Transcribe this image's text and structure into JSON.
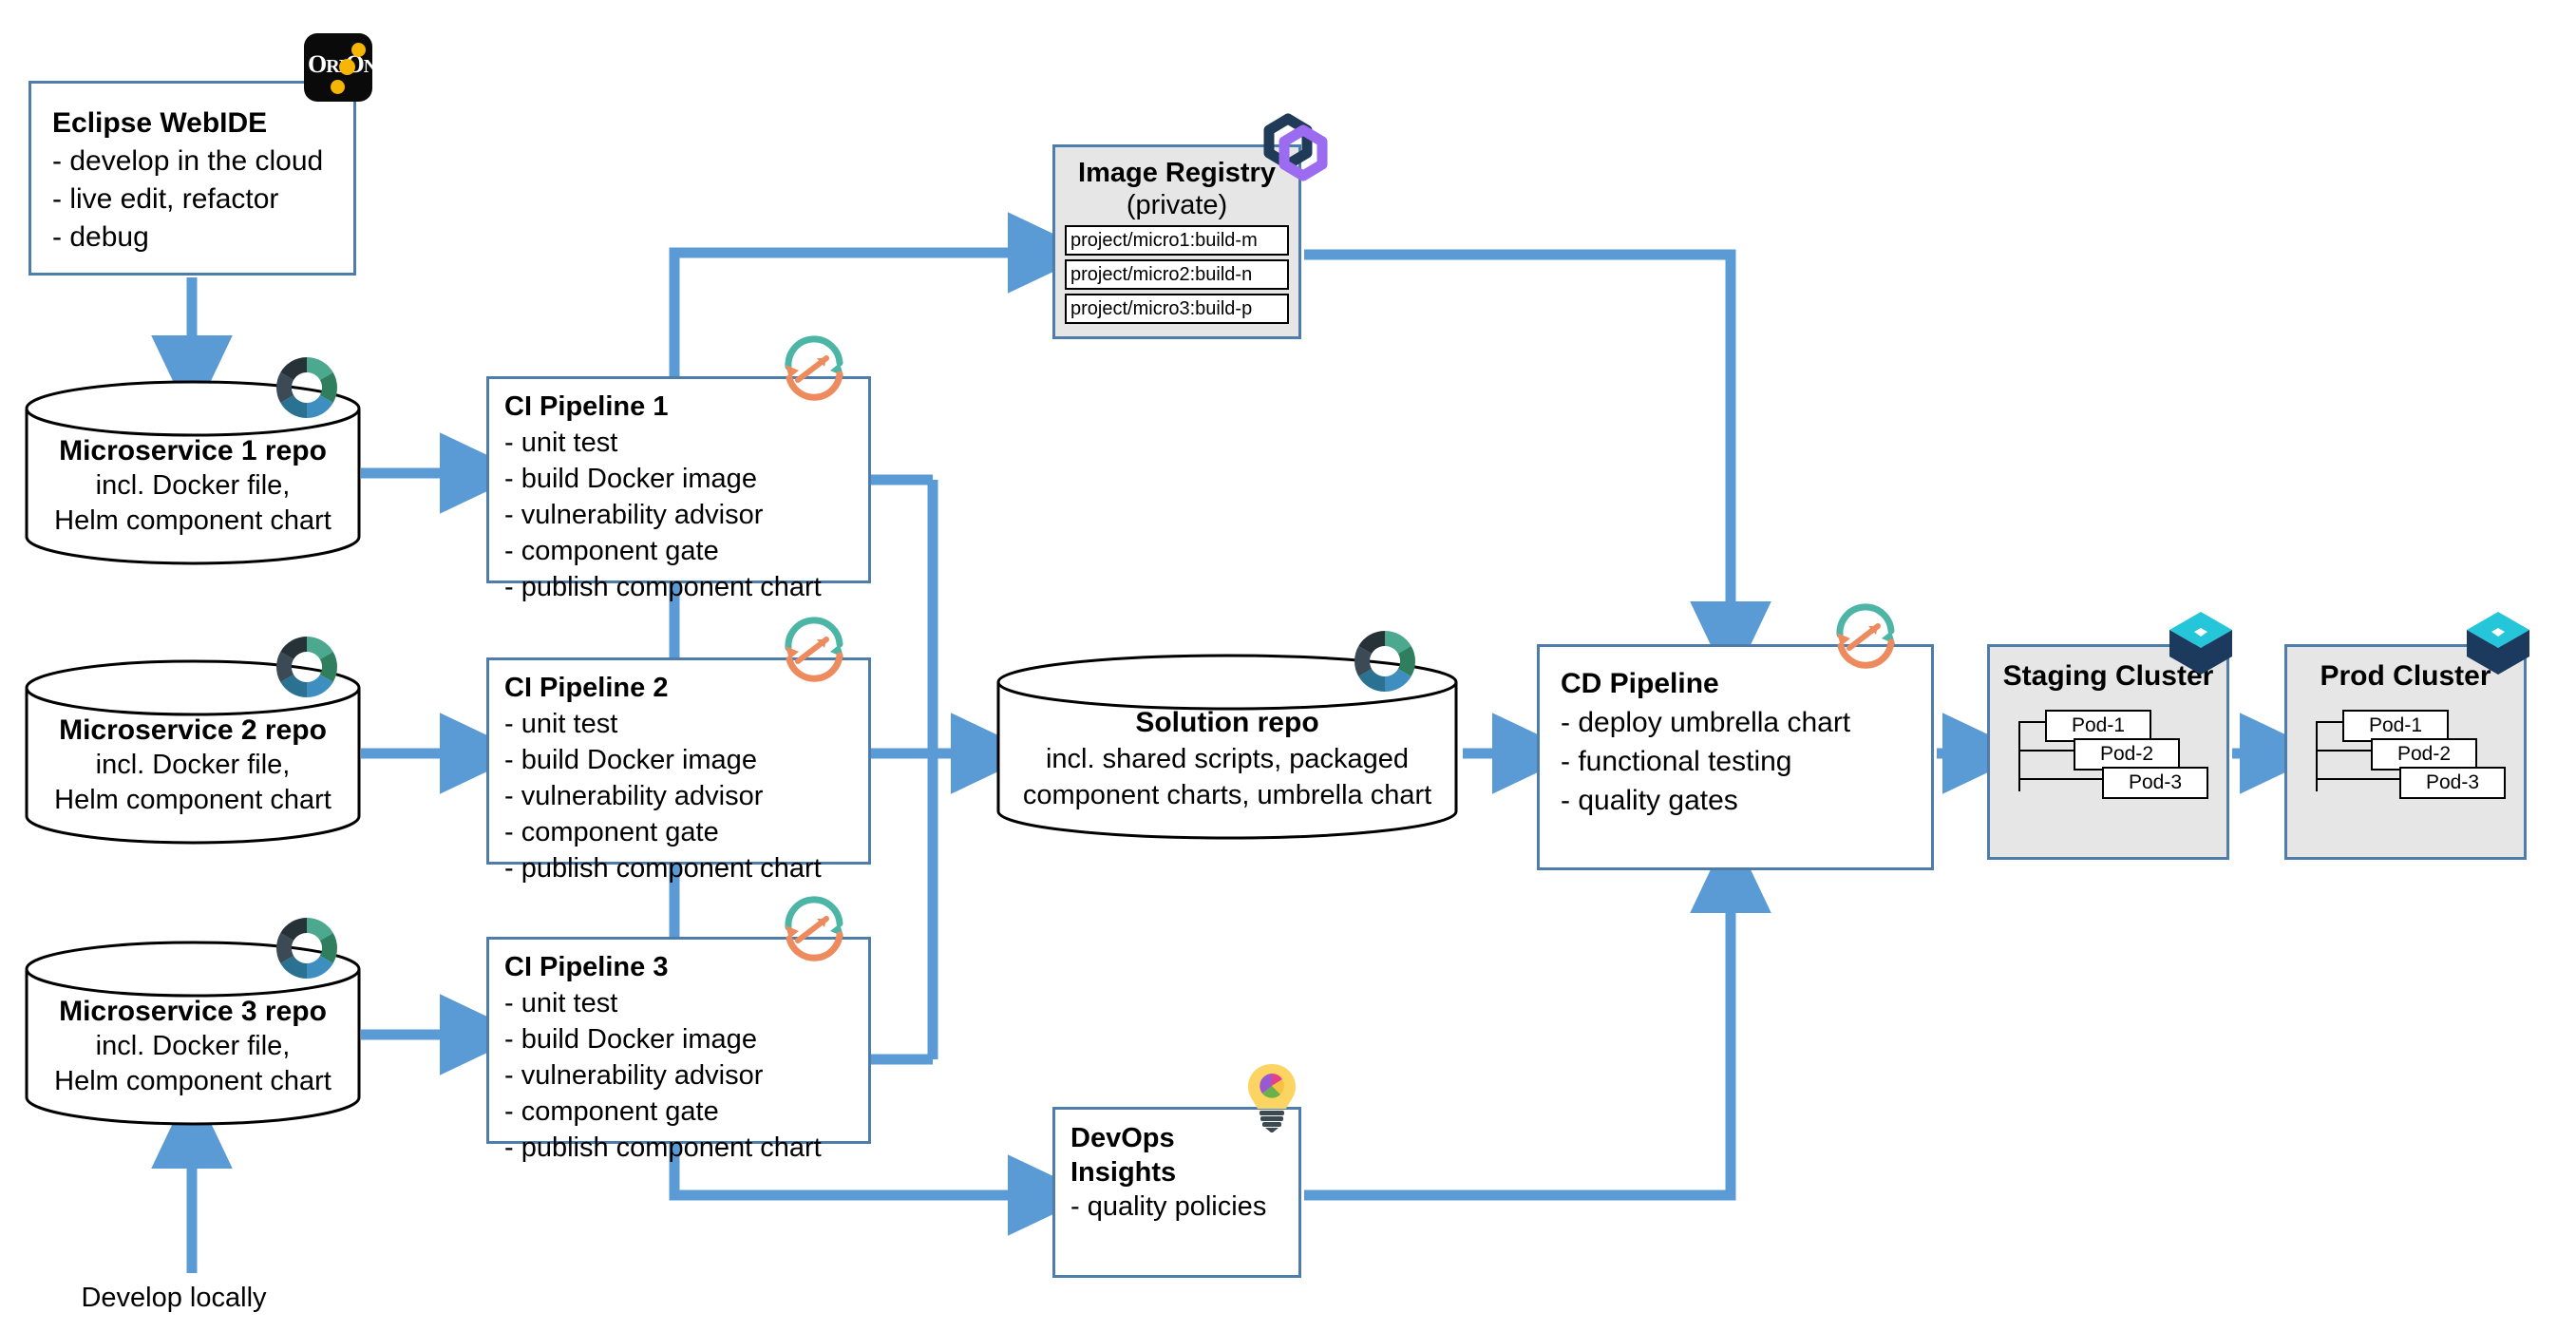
{
  "colors": {
    "arrow_blue": "#5B9BD5",
    "box_border_blue": "#4E7DAB",
    "cluster_fill": "#E6E6E6",
    "registry_fill": "#E6E6E6",
    "orion_black": "#0A0A0A",
    "orion_gold": "#F5B500",
    "ci_icon_teal": "#4CB5A5",
    "ci_icon_orange": "#ED8B5F",
    "cube_cyan": "#26C6DA",
    "cube_navy": "#1C3A5E",
    "registry_icon_navy": "#1F3B57",
    "registry_icon_purple": "#9B6BF0",
    "bulb_yellow": "#FBD461",
    "donut_segments": [
      "#4CA88F",
      "#2F7F5F",
      "#3E8FBF",
      "#2B7191",
      "#3C4A55",
      "#263238"
    ]
  },
  "webide": {
    "title": "Eclipse WebIDE",
    "lines": [
      "- develop in the cloud",
      "- live edit, refactor",
      "- debug"
    ],
    "icon": "orion-icon"
  },
  "repos": [
    {
      "title": "Microservice 1 repo",
      "lines": [
        "incl. Docker file,",
        "Helm component chart"
      ],
      "icon": "git-donut-icon"
    },
    {
      "title": "Microservice 2 repo",
      "lines": [
        "incl. Docker file,",
        "Helm component chart"
      ],
      "icon": "git-donut-icon"
    },
    {
      "title": "Microservice 3 repo",
      "lines": [
        "incl. Docker file,",
        "Helm component chart"
      ],
      "icon": "git-donut-icon"
    }
  ],
  "ci_pipelines": [
    {
      "title": "CI Pipeline 1",
      "steps": [
        "- unit test",
        "- build Docker image",
        "- vulnerability advisor",
        "- component gate",
        "- publish component chart"
      ],
      "icon": "continuous-delivery-icon"
    },
    {
      "title": "CI Pipeline 2",
      "steps": [
        "- unit test",
        "- build Docker image",
        "- vulnerability advisor",
        "- component gate",
        "- publish component chart"
      ],
      "icon": "continuous-delivery-icon"
    },
    {
      "title": "CI Pipeline 3",
      "steps": [
        "- unit test",
        "- build Docker image",
        "- vulnerability advisor",
        "- component gate",
        "- publish component chart"
      ],
      "icon": "continuous-delivery-icon"
    }
  ],
  "registry": {
    "title": "Image Registry",
    "subtitle": "(private)",
    "images": [
      "project/micro1:build-m",
      "project/micro2:build-n",
      "project/micro3:build-p"
    ],
    "icon": "container-registry-icon"
  },
  "solution_repo": {
    "title": "Solution repo",
    "lines": [
      "incl. shared scripts, packaged",
      "component charts, umbrella chart"
    ],
    "icon": "git-donut-icon"
  },
  "cd_pipeline": {
    "title": "CD Pipeline",
    "steps": [
      "- deploy umbrella chart",
      "- functional testing",
      "- quality gates"
    ],
    "icon": "continuous-delivery-icon"
  },
  "insights": {
    "title_line1": "DevOps",
    "title_line2": "Insights",
    "lines": [
      "- quality policies"
    ],
    "icon": "insights-bulb-icon"
  },
  "clusters": [
    {
      "title": "Staging Cluster",
      "pods": [
        "Pod-1",
        "Pod-2",
        "Pod-3"
      ],
      "icon": "kubernetes-cube-icon"
    },
    {
      "title": "Prod Cluster",
      "pods": [
        "Pod-1",
        "Pod-2",
        "Pod-3"
      ],
      "icon": "kubernetes-cube-icon"
    }
  ],
  "annotations": {
    "develop_locally": "Develop locally"
  }
}
